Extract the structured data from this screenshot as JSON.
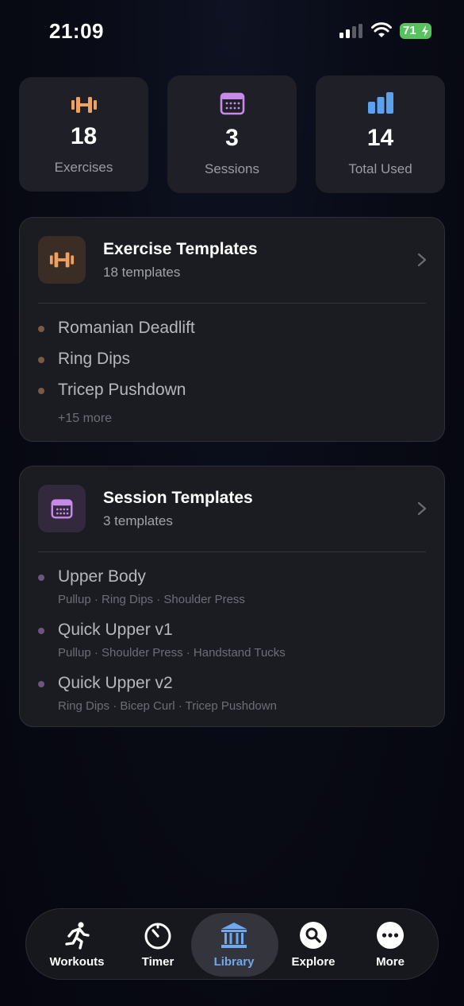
{
  "status_bar": {
    "time": "21:09",
    "battery": "71"
  },
  "stats": [
    {
      "value": "18",
      "label": "Exercises",
      "icon": "dumbbell-icon"
    },
    {
      "value": "3",
      "label": "Sessions",
      "icon": "calendar-icon"
    },
    {
      "value": "14",
      "label": "Total Used",
      "icon": "bar-chart-icon"
    }
  ],
  "exercise_templates": {
    "title": "Exercise Templates",
    "subtitle": "18 templates",
    "items": [
      "Romanian Deadlift",
      "Ring Dips",
      "Tricep Pushdown"
    ],
    "more": "+15 more"
  },
  "session_templates": {
    "title": "Session Templates",
    "subtitle": "3 templates",
    "items": [
      {
        "name": "Upper Body",
        "exercises": "Pullup · Ring Dips · Shoulder Press"
      },
      {
        "name": "Quick Upper v1",
        "exercises": "Pullup · Shoulder Press · Handstand Tucks"
      },
      {
        "name": "Quick Upper v2",
        "exercises": "Ring Dips · Bicep Curl · Tricep Pushdown"
      }
    ]
  },
  "tab_bar": {
    "tabs": [
      {
        "label": "Workouts",
        "icon": "running-figure-icon"
      },
      {
        "label": "Timer",
        "icon": "timer-icon"
      },
      {
        "label": "Library",
        "icon": "library-icon",
        "active": true
      },
      {
        "label": "Explore",
        "icon": "search-icon"
      },
      {
        "label": "More",
        "icon": "more-icon"
      }
    ]
  },
  "colors": {
    "exercise_accent": "#f0a060",
    "session_accent": "#c88ae8",
    "stats_accent": "#5aa2f0",
    "active_tab": "#6ea8f0",
    "battery": "#58c25f"
  }
}
